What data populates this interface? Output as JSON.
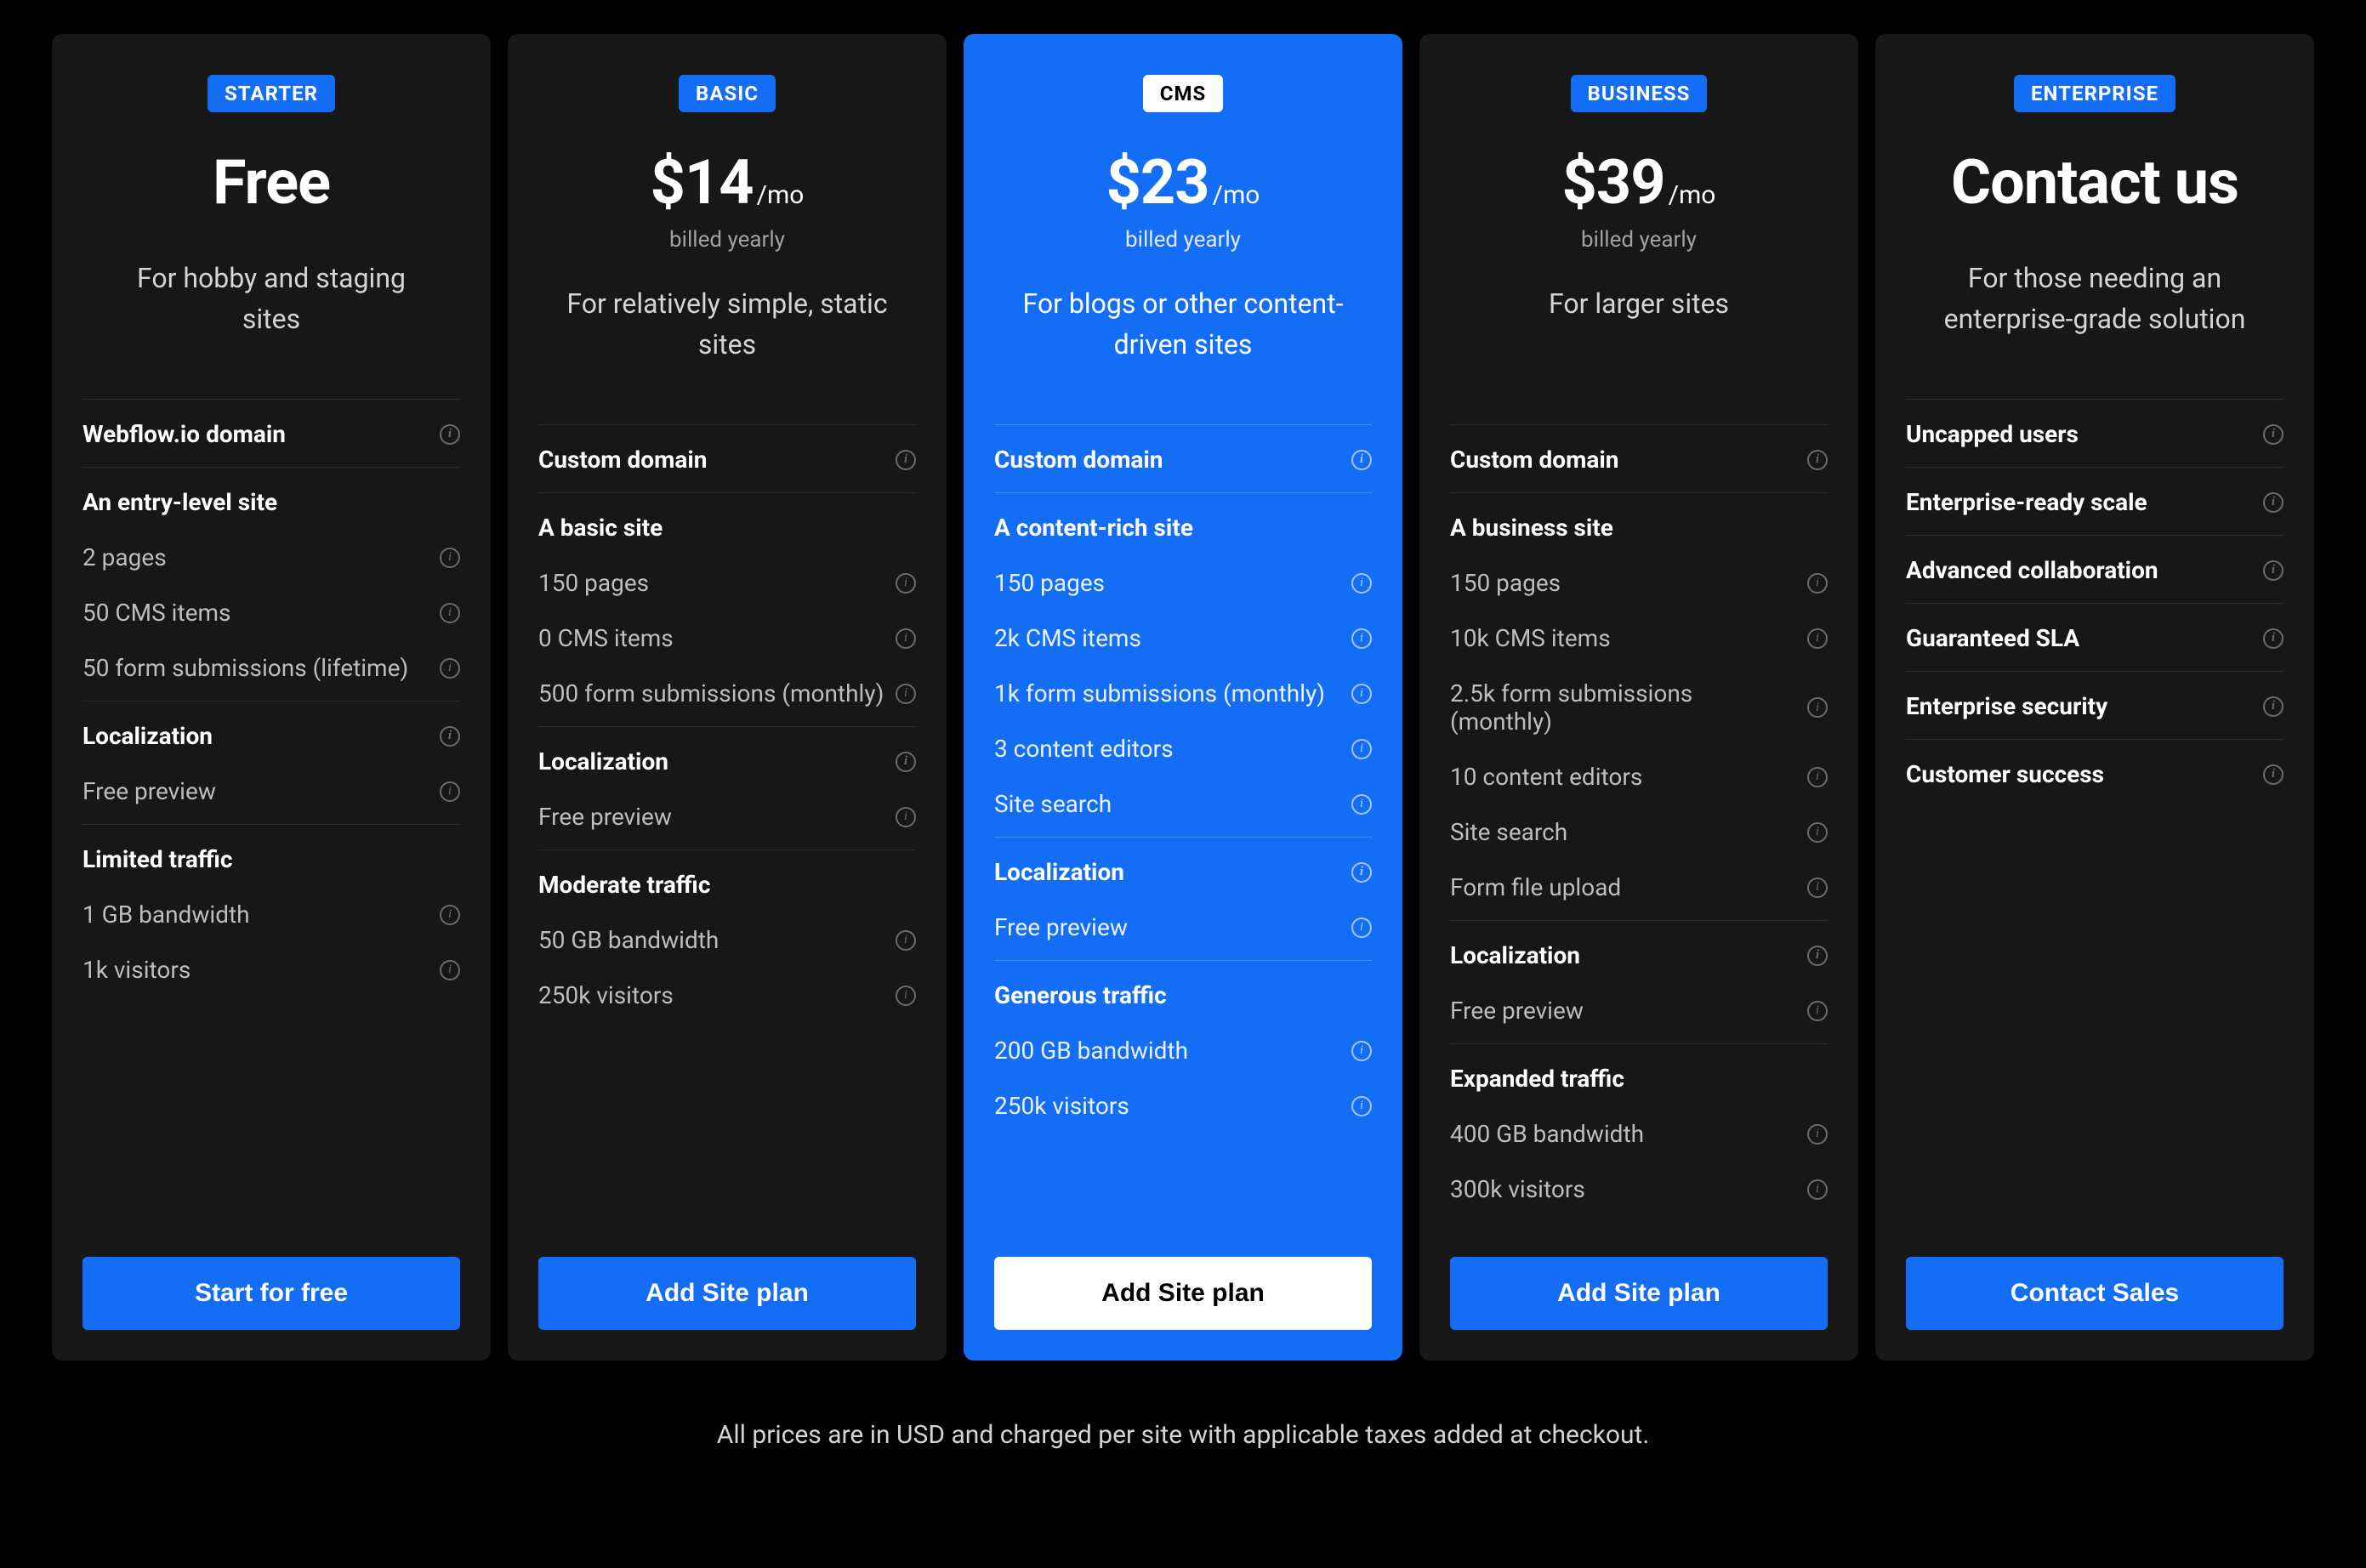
{
  "footnote": "All prices are in USD and charged per site with applicable taxes added at checkout.",
  "plans": [
    {
      "badge": "STARTER",
      "highlight": false,
      "price": "Free",
      "per": "",
      "billed": "",
      "desc": "For hobby and staging sites",
      "cta": "Start for free",
      "groups": [
        {
          "title": "Webflow.io domain",
          "info": true,
          "items": []
        },
        {
          "title": "An entry-level site",
          "info": false,
          "items": [
            {
              "label": "2 pages",
              "info": true
            },
            {
              "label": "50 CMS items",
              "info": true
            },
            {
              "label": "50 form submissions (lifetime)",
              "info": true
            }
          ]
        },
        {
          "title": "Localization",
          "info": true,
          "items": [
            {
              "label": "Free preview",
              "info": true
            }
          ]
        },
        {
          "title": "Limited traffic",
          "info": false,
          "items": [
            {
              "label": "1 GB bandwidth",
              "info": true
            },
            {
              "label": "1k visitors",
              "info": true
            }
          ]
        }
      ]
    },
    {
      "badge": "BASIC",
      "highlight": false,
      "price": "$14",
      "per": "/mo",
      "billed": "billed yearly",
      "desc": "For relatively simple, static sites",
      "cta": "Add Site plan",
      "groups": [
        {
          "title": "Custom domain",
          "info": true,
          "items": []
        },
        {
          "title": "A basic site",
          "info": false,
          "items": [
            {
              "label": "150 pages",
              "info": true
            },
            {
              "label": "0 CMS items",
              "info": true
            },
            {
              "label": "500 form submissions (monthly)",
              "info": true
            }
          ]
        },
        {
          "title": "Localization",
          "info": true,
          "items": [
            {
              "label": "Free preview",
              "info": true
            }
          ]
        },
        {
          "title": "Moderate traffic",
          "info": false,
          "items": [
            {
              "label": "50 GB bandwidth",
              "info": true
            },
            {
              "label": "250k visitors",
              "info": true
            }
          ]
        }
      ]
    },
    {
      "badge": "CMS",
      "highlight": true,
      "price": "$23",
      "per": "/mo",
      "billed": "billed yearly",
      "desc": "For blogs or other content-driven sites",
      "cta": "Add Site plan",
      "groups": [
        {
          "title": "Custom domain",
          "info": true,
          "items": []
        },
        {
          "title": "A content-rich site",
          "info": false,
          "items": [
            {
              "label": "150 pages",
              "info": true
            },
            {
              "label": "2k CMS items",
              "info": true
            },
            {
              "label": "1k form submissions (monthly)",
              "info": true
            },
            {
              "label": "3 content editors",
              "info": true
            },
            {
              "label": "Site search",
              "info": true
            }
          ]
        },
        {
          "title": "Localization",
          "info": true,
          "items": [
            {
              "label": "Free preview",
              "info": true
            }
          ]
        },
        {
          "title": "Generous traffic",
          "info": false,
          "items": [
            {
              "label": "200 GB bandwidth",
              "info": true
            },
            {
              "label": "250k visitors",
              "info": true
            }
          ]
        }
      ]
    },
    {
      "badge": "BUSINESS",
      "highlight": false,
      "price": "$39",
      "per": "/mo",
      "billed": "billed yearly",
      "desc": "For larger sites",
      "cta": "Add Site plan",
      "groups": [
        {
          "title": "Custom domain",
          "info": true,
          "items": []
        },
        {
          "title": "A business site",
          "info": false,
          "items": [
            {
              "label": "150 pages",
              "info": true
            },
            {
              "label": "10k CMS items",
              "info": true
            },
            {
              "label": "2.5k form submissions (monthly)",
              "info": true
            },
            {
              "label": "10 content editors",
              "info": true
            },
            {
              "label": "Site search",
              "info": true
            },
            {
              "label": "Form file upload",
              "info": true
            }
          ]
        },
        {
          "title": "Localization",
          "info": true,
          "items": [
            {
              "label": "Free preview",
              "info": true
            }
          ]
        },
        {
          "title": "Expanded traffic",
          "info": false,
          "items": [
            {
              "label": "400 GB bandwidth",
              "info": true
            },
            {
              "label": "300k visitors",
              "info": true
            }
          ]
        }
      ]
    },
    {
      "badge": "ENTERPRISE",
      "highlight": false,
      "price": "Contact us",
      "per": "",
      "billed": "",
      "desc": "For those needing  an enterprise-grade solution",
      "cta": "Contact Sales",
      "groups": [
        {
          "title": "Uncapped users",
          "info": true,
          "items": []
        },
        {
          "title": "Enterprise-ready scale",
          "info": true,
          "items": []
        },
        {
          "title": "Advanced collaboration",
          "info": true,
          "items": []
        },
        {
          "title": "Guaranteed SLA",
          "info": true,
          "items": []
        },
        {
          "title": "Enterprise security",
          "info": true,
          "items": []
        },
        {
          "title": "Customer success",
          "info": true,
          "items": []
        }
      ]
    }
  ]
}
